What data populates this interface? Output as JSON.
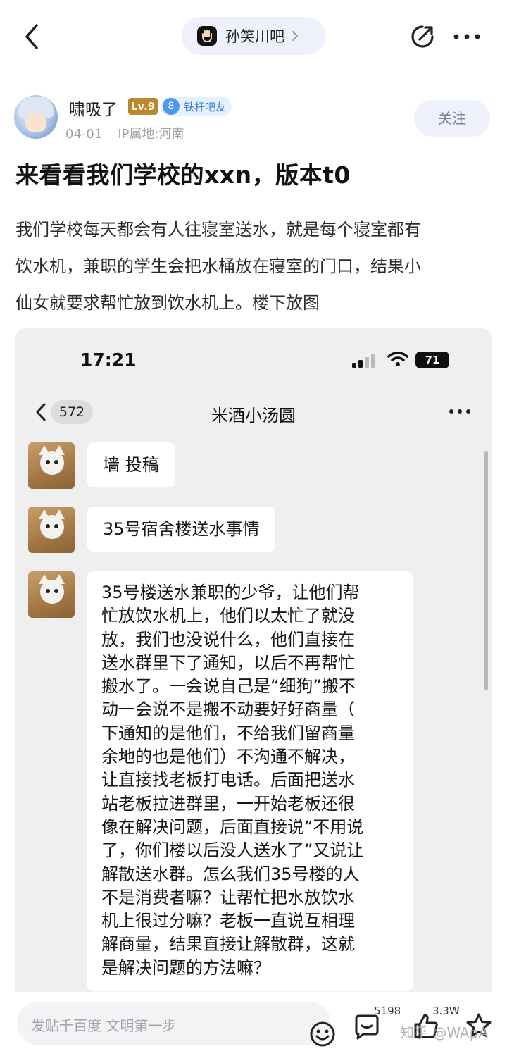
{
  "header": {
    "forum_name": "孙笑川吧",
    "icons": [
      "back-icon",
      "share-icon",
      "more-icon"
    ]
  },
  "author": {
    "name": "啸吸了",
    "level": "Lv.9",
    "fan_level": "8",
    "fan_label": "铁杆吧友",
    "date": "04-01",
    "ip": "IP属地:河南",
    "follow_label": "关注"
  },
  "post": {
    "title": "来看看我们学校的xxn，版本t0",
    "body_lines": [
      "我们学校每天都会有人往寝室送水，就是每个寝室都有",
      "饮水机，兼职的学生会把水桶放在寝室的门口，结果小",
      "仙女就要求帮忙放到饮水机上。楼下放图"
    ]
  },
  "screenshot": {
    "time": "17:21",
    "battery": "71",
    "unread_count": "572",
    "chat_title": "米酒小汤圆",
    "messages": [
      {
        "lines": [
          "墙 投稿"
        ]
      },
      {
        "lines": [
          "35号宿舍楼送水事情"
        ]
      },
      {
        "lines": [
          "35号楼送水兼职的少爷，让他们帮",
          "忙放饮水机上，他们以太忙了就没",
          "放，我们也没说什么，他们直接在",
          "送水群里下了通知，以后不再帮忙",
          "搬水了。一会说自己是“细狗”搬不",
          "动一会说不是搬不动要好好商量（",
          "下通知的是他们，不给我们留商量",
          "余地的也是他们）不沟通不解决，",
          "让直接找老板打电话。后面把送水",
          "站老板拉进群里，一开始老板还很",
          "像在解决问题，后面直接说“不用说",
          "了，你们楼以后没人送水了”又说让",
          "解散送水群。怎么我们35号楼的人",
          "不是消费者嘛？让帮忙把水放饮水",
          "机上很过分嘛？老板一直说互相理",
          "解商量，结果直接让解散群，这就",
          "是解决问题的方法嘛？"
        ]
      }
    ]
  },
  "bottom": {
    "placeholder": "发贴千百度 文明第一步",
    "comment_count": "5198",
    "like_count": "3.3W",
    "watermark": "知乎 @WApA"
  }
}
